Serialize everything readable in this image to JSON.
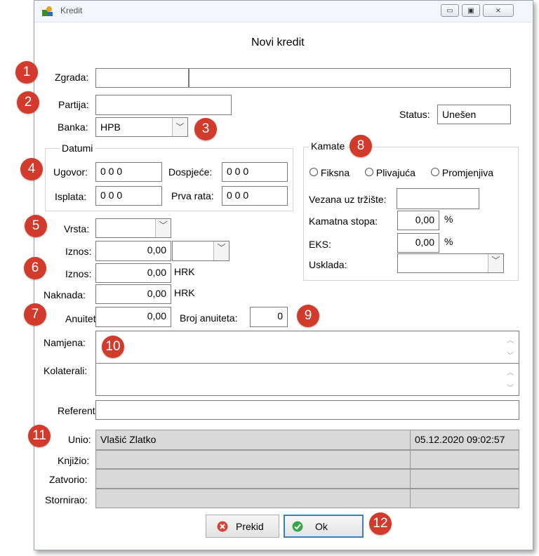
{
  "window": {
    "title": "Kredit"
  },
  "titlebar_buttons": {
    "minimize": "▭",
    "maximize": "▣",
    "close": "⨯"
  },
  "form_title": "Novi kredit",
  "fields": {
    "zgrada_label": "Zgrada:",
    "partija_label": "Partija:",
    "banka_label": "Banka:",
    "banka_value": "HPB",
    "status_label": "Status:",
    "status_value": "Unešen"
  },
  "datumi": {
    "title": "Datumi",
    "ugovor_label": "Ugovor:",
    "ugovor_value": "0 0 0",
    "dospijece_label": "Dospjeće:",
    "dospijece_value": "0 0 0",
    "isplata_label": "Isplata:",
    "isplata_value": "0 0 0",
    "prva_rata_label": "Prva rata:",
    "prva_rata_value": "0 0 0"
  },
  "kamate": {
    "title": "Kamate",
    "radio_fiksna": "Fiksna",
    "radio_plivajuca": "Plivajuća",
    "radio_promjenjiva": "Promjenjiva",
    "vezana_label": "Vezana uz tržište:",
    "kamatna_stopa_label": "Kamatna stopa:",
    "kamatna_stopa_value": "0,00",
    "eks_label": "EKS:",
    "eks_value": "0,00",
    "percent": "%",
    "uskladа_label": "Usklada:"
  },
  "amounts": {
    "vrsta_label": "Vrsta:",
    "iznos1_label": "Iznos:",
    "iznos1_value": "0,00",
    "iznos2_label": "Iznos:",
    "iznos2_value": "0,00",
    "iznos2_currency": "HRK",
    "naknada_label": "Naknada:",
    "naknada_value": "0,00",
    "naknada_currency": "HRK",
    "anuitet_label": "Anuitet",
    "anuitet_value": "0,00",
    "broj_anuiteta_label": "Broj anuiteta:",
    "broj_anuiteta_value": "0"
  },
  "notes": {
    "namjena_label": "Namjena:",
    "kolaterali_label": "Kolaterali:",
    "referent_label": "Referent"
  },
  "audit": {
    "unio_label": "Unio:",
    "unio_name": "Vlašić Zlatko",
    "unio_date": "05.12.2020 09:02:57",
    "knjizio_label": "Knjižio:",
    "zatvorio_label": "Zatvorio:",
    "stornirao_label": "Stornirao:"
  },
  "buttons": {
    "prekid": "Prekid",
    "ok": "Ok"
  },
  "badges": [
    "1",
    "2",
    "3",
    "4",
    "5",
    "6",
    "7",
    "8",
    "9",
    "10",
    "11",
    "12"
  ],
  "colors": {
    "badge": "#d23b2c",
    "ok_border": "#3c7fb1"
  }
}
